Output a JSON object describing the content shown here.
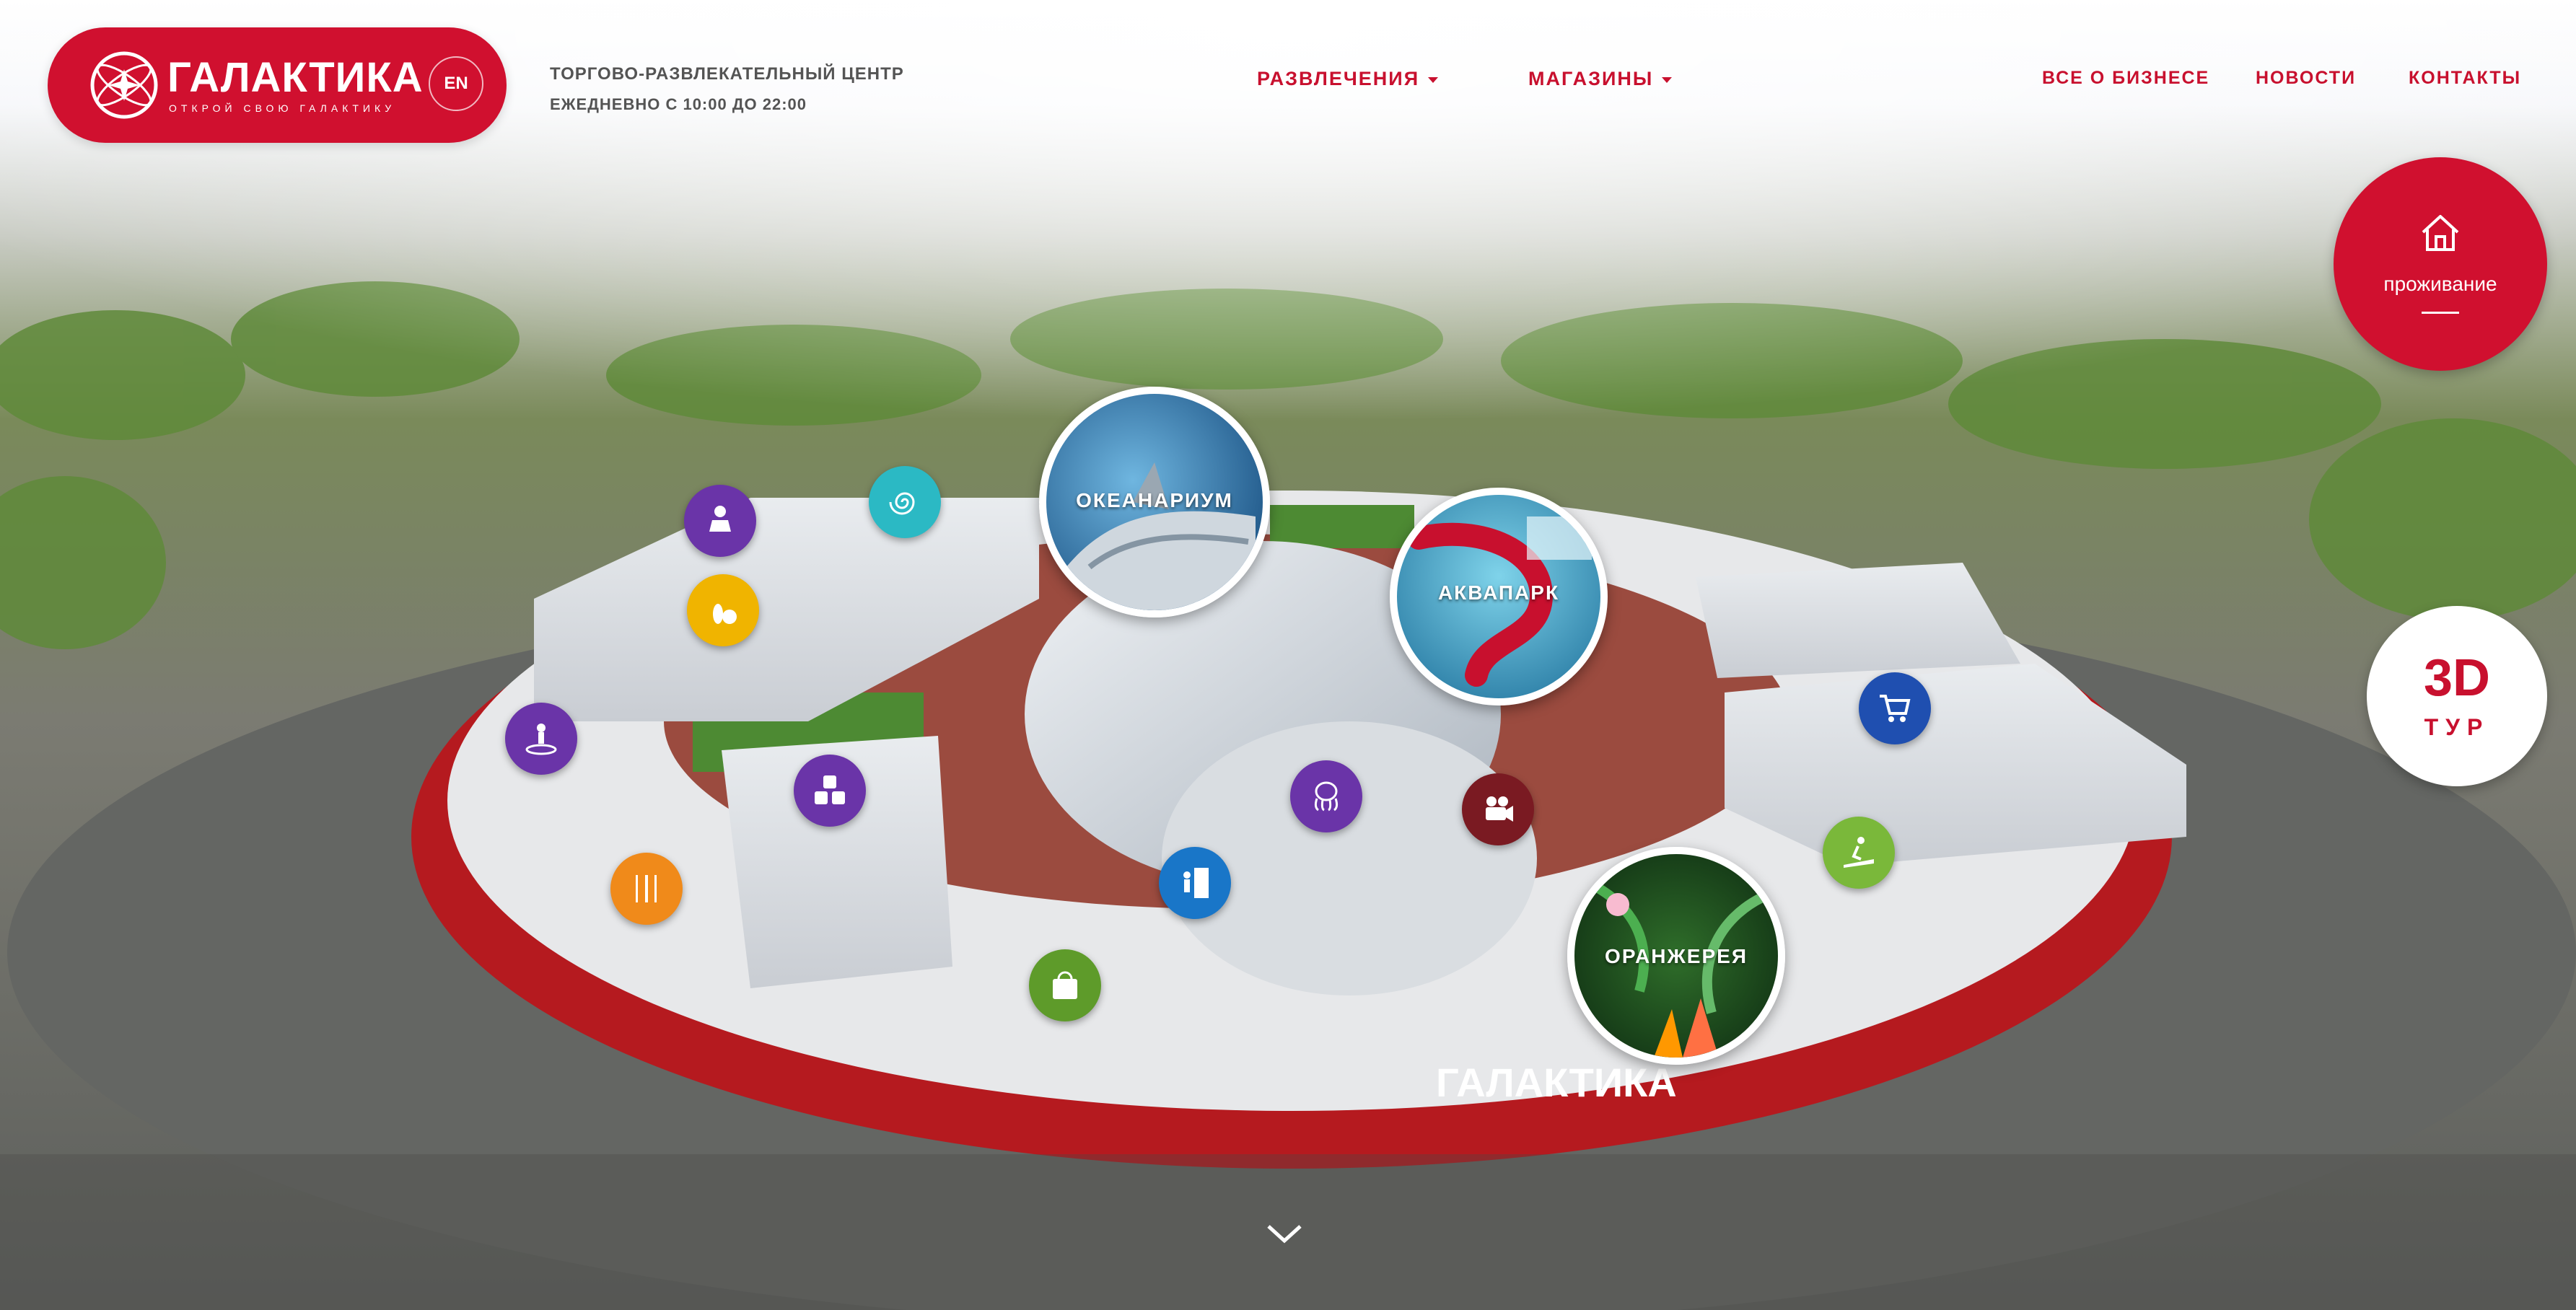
{
  "header": {
    "logo": {
      "name": "ГАЛАКТИКА",
      "tagline": "ОТКРОЙ СВОЮ ГАЛАКТИКУ"
    },
    "language_button": "EN",
    "info": {
      "line1": "ТОРГОВО-РАЗВЛЕКАТЕЛЬНЫЙ ЦЕНТР",
      "line2": "ЕЖЕДНЕВНО С 10:00 ДО 22:00"
    },
    "nav": {
      "entertainment": "РАЗВЛЕЧЕНИЯ",
      "shops": "МАГАЗИНЫ",
      "business": "ВСЕ О БИЗНЕСЕ",
      "news": "НОВОСТИ",
      "contacts": "КОНТАКТЫ"
    }
  },
  "map": {
    "bubbles": {
      "oceanarium": "ОКЕАНАРИУМ",
      "aquapark": "АКВАПАРК",
      "greenhouse": "ОРАНЖЕРЕЯ"
    },
    "building_sign": "ГАЛАКТИКА",
    "poi_icons": [
      {
        "name": "kids-zone-icon",
        "color": "#6a34a8"
      },
      {
        "name": "spiral-icon",
        "color": "#2bb9c4"
      },
      {
        "name": "bowling-icon",
        "color": "#f0b400"
      },
      {
        "name": "trampoline-icon",
        "color": "#6a34a8"
      },
      {
        "name": "cubes-icon",
        "color": "#6a34a8"
      },
      {
        "name": "food-court-icon",
        "color": "#f08a1a"
      },
      {
        "name": "shopping-bag-icon",
        "color": "#5e9b2a"
      },
      {
        "name": "climbing-wall-icon",
        "color": "#1976c8"
      },
      {
        "name": "octopus-icon",
        "color": "#6a34a8"
      },
      {
        "name": "cinema-camera-icon",
        "color": "#7a1a22"
      },
      {
        "name": "shopping-cart-icon",
        "color": "#1f4fb0"
      },
      {
        "name": "fitness-treadmill-icon",
        "color": "#7ab83a"
      }
    ]
  },
  "side": {
    "housing": "проживание",
    "tour_big": "3D",
    "tour_small": "ТУР"
  },
  "colors": {
    "brand": "#d0102f",
    "text_dark": "#545454"
  }
}
